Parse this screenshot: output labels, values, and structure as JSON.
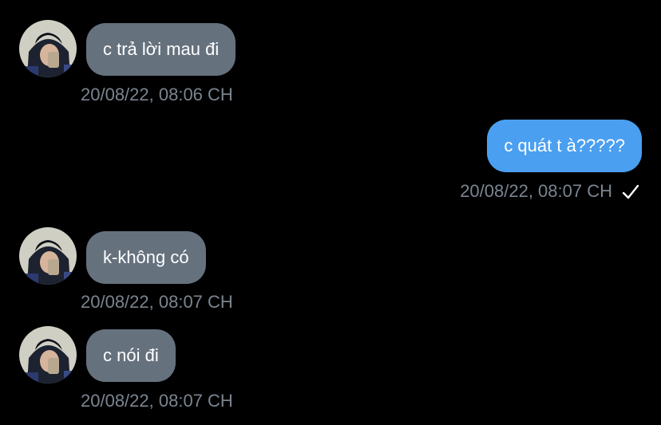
{
  "colors": {
    "background": "#000000",
    "incoming_bubble": "#66717e",
    "outgoing_bubble": "#4a9ff0",
    "timestamp": "#7b8590"
  },
  "messages": [
    {
      "direction": "incoming",
      "text": "c trả lời mau đi",
      "time": "20/08/22, 08:06 CH",
      "avatar_icon": "profile-photo"
    },
    {
      "direction": "outgoing",
      "text": "c quát t à?????",
      "time": "20/08/22, 08:07 CH",
      "status_icon": "checkmark-icon"
    },
    {
      "direction": "incoming",
      "text": "k-không có",
      "time": "20/08/22, 08:07 CH",
      "avatar_icon": "profile-photo"
    },
    {
      "direction": "incoming",
      "text": "c nói đi",
      "time": "20/08/22, 08:07 CH",
      "avatar_icon": "profile-photo"
    }
  ]
}
